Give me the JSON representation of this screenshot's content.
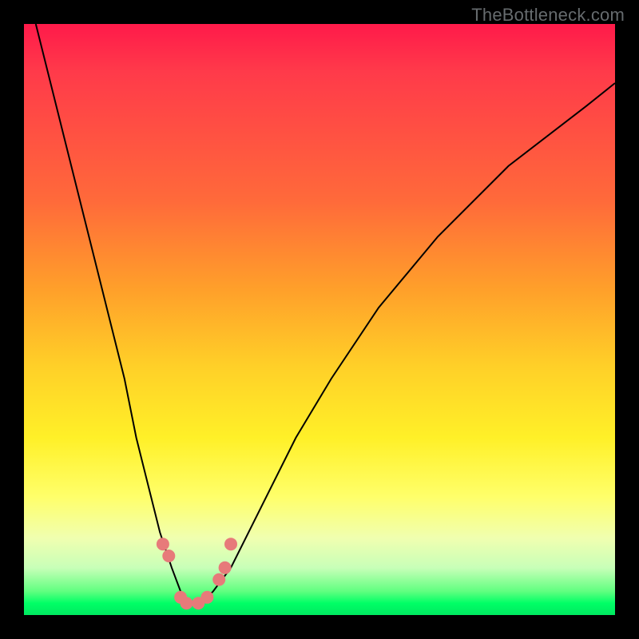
{
  "watermark": "TheBottleneck.com",
  "colors": {
    "frame": "#000000",
    "marker": "#e77a7a",
    "curve": "#000000"
  },
  "chart_data": {
    "type": "line",
    "title": "",
    "xlabel": "",
    "ylabel": "",
    "xlim": [
      0,
      100
    ],
    "ylim": [
      0,
      100
    ],
    "grid": false,
    "gradient_stops": [
      {
        "pos": 0,
        "color": "#ff1a4a"
      },
      {
        "pos": 8,
        "color": "#ff3a4a"
      },
      {
        "pos": 30,
        "color": "#ff6a3a"
      },
      {
        "pos": 45,
        "color": "#ffa02a"
      },
      {
        "pos": 58,
        "color": "#ffd028"
      },
      {
        "pos": 70,
        "color": "#fff028"
      },
      {
        "pos": 80,
        "color": "#ffff6a"
      },
      {
        "pos": 87,
        "color": "#f0ffb0"
      },
      {
        "pos": 92,
        "color": "#c8ffb8"
      },
      {
        "pos": 96,
        "color": "#60ff80"
      },
      {
        "pos": 98,
        "color": "#00ff66"
      },
      {
        "pos": 100,
        "color": "#00e860"
      }
    ],
    "series": [
      {
        "name": "bottleneck-curve",
        "x": [
          2,
          5,
          8,
          11,
          14,
          17,
          19,
          21,
          23,
          25,
          26.5,
          28,
          30,
          32,
          35,
          38,
          42,
          46,
          52,
          60,
          70,
          82,
          95,
          100
        ],
        "values": [
          100,
          88,
          76,
          64,
          52,
          40,
          30,
          22,
          14,
          8,
          4,
          2,
          2,
          4,
          8,
          14,
          22,
          30,
          40,
          52,
          64,
          76,
          86,
          90
        ]
      }
    ],
    "markers": [
      {
        "x": 23.5,
        "y": 12
      },
      {
        "x": 24.5,
        "y": 10
      },
      {
        "x": 26.5,
        "y": 3
      },
      {
        "x": 27.5,
        "y": 2
      },
      {
        "x": 29.5,
        "y": 2
      },
      {
        "x": 31,
        "y": 3
      },
      {
        "x": 33,
        "y": 6
      },
      {
        "x": 34,
        "y": 8
      },
      {
        "x": 35,
        "y": 12
      }
    ]
  }
}
